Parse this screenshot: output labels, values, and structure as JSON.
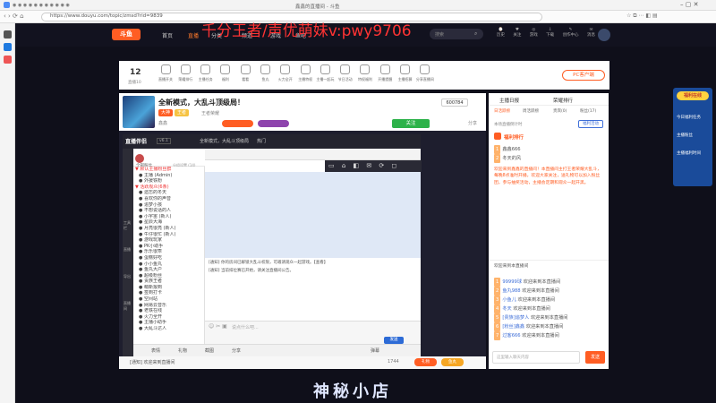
{
  "browser": {
    "tab_title": "鑫鑫的直播间 - 斗鱼",
    "url": "https://www.douyu.com/topic/zmsd?rid=9839"
  },
  "watermark": "千分王者/声优萌妹v:pwy9706",
  "site_nav": {
    "logo": "斗鱼",
    "items": [
      "首页",
      "直播",
      "分类",
      "频道",
      "游戏",
      "鱼吧"
    ],
    "active_index": 1,
    "search_placeholder": "搜索",
    "right_items": [
      "历史",
      "关注",
      "游戏",
      "下载",
      "创作中心",
      "消息"
    ]
  },
  "info_bar": {
    "count": "12",
    "count_label": "直播10",
    "items": [
      "直播开关",
      "荣耀排行",
      "主播任务",
      "福利",
      "看看",
      "鱼丸",
      "火力全开",
      "主播特权",
      "主播一起玩",
      "节日活动",
      "特权福利",
      "开播提醒",
      "主播招募",
      "分享直播间"
    ],
    "pc_button": "PC客户端"
  },
  "room": {
    "title": "全新模式，大乱斗顶级局！",
    "category": "王者荣耀",
    "anchor": "鑫鑫",
    "id": "600784",
    "tags": [
      "大神",
      "王者"
    ],
    "follow": "关注",
    "share": "分享"
  },
  "inner_app": {
    "logo": "直播伴侣",
    "version": "v6.1",
    "tabs": [
      "全新模式，大乱斗顶级局",
      "热门"
    ],
    "sidebar": [
      "工具栏",
      "直播",
      "导出",
      "直播间"
    ],
    "group_header": "全部粉丝",
    "group_count": "分组设置 (14)",
    "groups": [
      "▼ 默认主播粉丝群",
      "● 主播 (Admin)",
      "● 外援铁粉",
      "▼ 活跃观众(6条)",
      "● 遗忘的冬天",
      "● 喜欢你的声音",
      "● 追梦小孩",
      "● 不想说话的人",
      "● 小宇宙 (新人)",
      "● 星辰大海",
      "● 月亮很亮 (新人)",
      "● 牛仔很忙 (新人)",
      "● 游戏玩家",
      "● PK小助手",
      "● 乐乐很乖",
      "● 蛋糕好吃",
      "● 小小鱼丸",
      "● 鱼丸大户",
      "● 超级粉丝",
      "● 贵族王者",
      "● 萌新报到",
      "● 签到打卡",
      "● 空间站",
      "● 网易云音乐",
      "● 老铁在线",
      "● 火力全开",
      "● 主播小助手",
      "● 大乱斗达人"
    ],
    "chat_lines": [
      "[通知] 你的房间已解锁大乱斗权限，可邀请观众一起游戏。【查看】",
      "[通知] 当前排位赛已开始，请关注直播间公告。"
    ],
    "input_placeholder": "说点什么吧...",
    "bottom_tools": [
      "表情",
      "礼物",
      "截图",
      "分享",
      "弹幕"
    ],
    "send": "发送"
  },
  "bottom_bar": {
    "label": "[通知] 欢迎来到直播间",
    "count": "1744",
    "buttons": [
      "礼物",
      "鱼丸",
      "1744"
    ]
  },
  "right_panel": {
    "tabs": [
      "主播日报",
      "荣耀排行"
    ],
    "sub_tabs": [
      "日活跃榜",
      "周活跃榜",
      "贵宾(0)",
      "粉丝(17)"
    ],
    "notice": "本场直播倒计时",
    "notice_button": "福利活动",
    "rank_title": "福利排行",
    "users": [
      "鑫鑫666",
      "冬天的风"
    ],
    "announcement": "欢迎来到鑫鑫的直播间！本直播间主打王者荣耀大乱斗，每晚8点准时开播，欢迎大家关注，送礼物可以加入粉丝团，参与抽奖活动，主播会定期和观众一起开黑。",
    "join_text": "欢迎来到本直播间",
    "danmu": [
      {
        "user": "99999球",
        "msg": "欢迎来到本直播间"
      },
      {
        "user": "鱼丸988",
        "msg": "欢迎来到本直播间"
      },
      {
        "user": "小鱼儿",
        "msg": "欢迎来到本直播间"
      },
      {
        "user": "冬天",
        "msg": "欢迎来到本直播间"
      },
      {
        "user": "[贵族]追梦人",
        "msg": "欢迎来到本直播间"
      },
      {
        "user": "[粉丝]鑫鑫",
        "msg": "欢迎来到本直播间"
      },
      {
        "user": "过客666",
        "msg": "欢迎来到本直播间"
      }
    ],
    "input_placeholder": "这里输入聊天内容",
    "send": "发送"
  },
  "promo": {
    "badge": "福利在线",
    "lines": [
      "今日福利任务",
      "主播粉丝",
      "主播福利时间"
    ]
  },
  "shop_banner": "神秘小店",
  "colors": {
    "accent": "#ff7a2b",
    "douyu_orange": "#ff5d23",
    "watermark": "#ff3333",
    "inner_dark": "#23232e"
  }
}
